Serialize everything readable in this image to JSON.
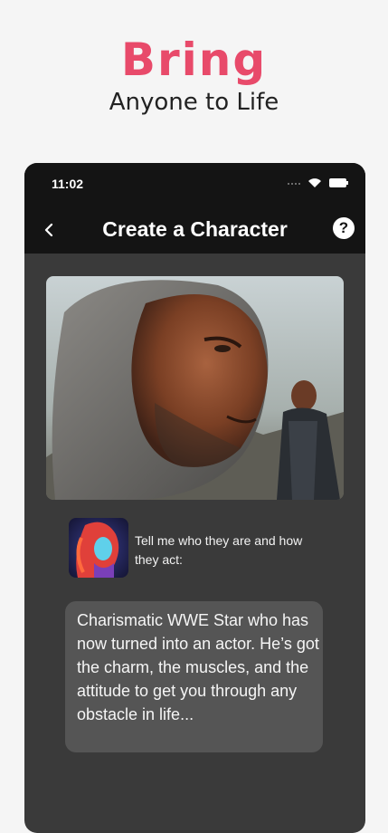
{
  "hero": {
    "title": "Bring",
    "subtitle": "Anyone to Life"
  },
  "status_bar": {
    "time": "11:02",
    "icons": [
      "signal-dots-icon",
      "wifi-icon",
      "battery-icon"
    ]
  },
  "app_bar": {
    "title": "Create a Character",
    "back_icon": "chevron-left-icon",
    "help_label": "?"
  },
  "main": {
    "prompt": "Tell me who they are and how they act:",
    "description": "Charismatic WWE Star who has now turned into an actor. He’s got the charm, the muscles, and the attitude to get you through any obstacle in life..."
  },
  "colors": {
    "accent": "#e84a6a",
    "phone_bg": "#3a3a3a",
    "bar_bg": "#141414",
    "bubble_bg": "#555555"
  }
}
